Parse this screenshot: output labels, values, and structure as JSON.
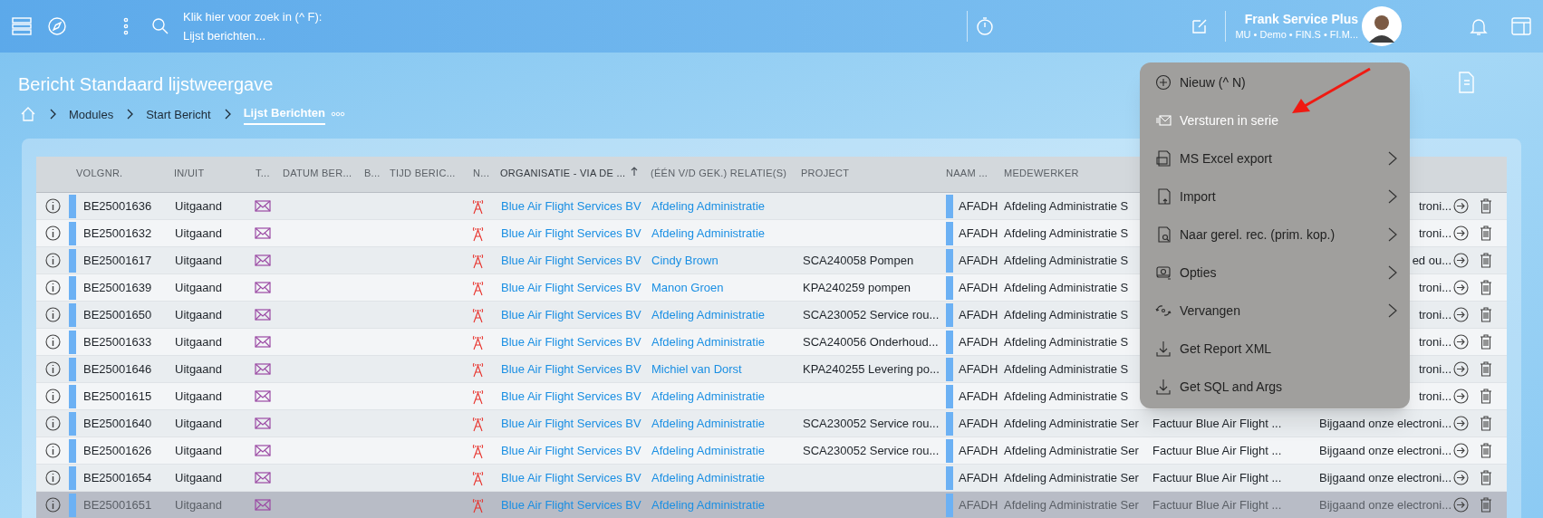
{
  "topbar": {
    "search": {
      "line_1": "Klik hier voor zoek in (^ F):",
      "line_2": "Lijst berichten..."
    },
    "user": {
      "name": "Frank Service Plus",
      "subtitle": "MU • Demo • FIN.S • FI.M..."
    }
  },
  "page_title": "Bericht Standaard lijstweergave",
  "breadcrumb": [
    {
      "label": "Modules",
      "selected": false
    },
    {
      "label": "Start Bericht",
      "selected": false
    },
    {
      "label": "Lijst Berichten",
      "selected": true
    }
  ],
  "table": {
    "columns": [
      {
        "label": "VOLGNR.",
        "sorted": false
      },
      {
        "label": "IN/UIT",
        "sorted": false
      },
      {
        "label": "T...",
        "sorted": false
      },
      {
        "label": "DATUM BER...",
        "sorted": false
      },
      {
        "label": "B...",
        "sorted": false
      },
      {
        "label": "TIJD BERIC...",
        "sorted": false
      },
      {
        "label": "N...",
        "sorted": false
      },
      {
        "label": "ORGANISATIE - VIA DE ...",
        "sorted": true
      },
      {
        "label": "(ÉÉN V/D GEK.) RELATIE(S)",
        "sorted": false
      },
      {
        "label": "PROJECT",
        "sorted": false
      },
      {
        "label": "NAAM ...",
        "sorted": false
      },
      {
        "label": "MEDEWERKER",
        "sorted": false
      }
    ],
    "rows": [
      {
        "selected": false,
        "number": "BE25001636",
        "direction": "Uitgaand",
        "organisation": "Blue Air Flight Services BV",
        "relation": "Afdeling Administratie",
        "name": "AFADH",
        "employee": "Afdeling Administratie S",
        "note": "troni..."
      },
      {
        "selected": false,
        "number": "BE25001632",
        "direction": "Uitgaand",
        "organisation": "Blue Air Flight Services BV",
        "relation": "Afdeling Administratie",
        "name": "AFADH",
        "employee": "Afdeling Administratie S",
        "note": "troni..."
      },
      {
        "selected": false,
        "number": "BE25001617",
        "direction": "Uitgaand",
        "organisation": "Blue Air Flight Services BV",
        "relation": "Cindy Brown",
        "project": "SCA240058 Pompen",
        "name": "AFADH",
        "employee": "Afdeling Administratie S",
        "note": "ed ou..."
      },
      {
        "selected": false,
        "number": "BE25001639",
        "direction": "Uitgaand",
        "organisation": "Blue Air Flight Services BV",
        "relation": "Manon Groen",
        "project": "KPA240259 pompen",
        "name": "AFADH",
        "employee": "Afdeling Administratie S",
        "note": "troni..."
      },
      {
        "selected": false,
        "number": "BE25001650",
        "direction": "Uitgaand",
        "organisation": "Blue Air Flight Services BV",
        "relation": "Afdeling Administratie",
        "project": "SCA230052 Service rou...",
        "name": "AFADH",
        "employee": "Afdeling Administratie S",
        "note": "troni..."
      },
      {
        "selected": false,
        "number": "BE25001633",
        "direction": "Uitgaand",
        "organisation": "Blue Air Flight Services BV",
        "relation": "Afdeling Administratie",
        "project": "SCA240056 Onderhoud...",
        "name": "AFADH",
        "employee": "Afdeling Administratie S",
        "note": "troni..."
      },
      {
        "selected": false,
        "number": "BE25001646",
        "direction": "Uitgaand",
        "organisation": "Blue Air Flight Services BV",
        "relation": "Michiel van Dorst",
        "project": "KPA240255 Levering po...",
        "name": "AFADH",
        "employee": "Afdeling Administratie S",
        "note": "troni..."
      },
      {
        "selected": false,
        "number": "BE25001615",
        "direction": "Uitgaand",
        "organisation": "Blue Air Flight Services BV",
        "relation": "Afdeling Administratie",
        "name": "AFADH",
        "employee": "Afdeling Administratie S",
        "note": "troni..."
      },
      {
        "selected": false,
        "number": "BE25001640",
        "direction": "Uitgaand",
        "organisation": "Blue Air Flight Services BV",
        "relation": "Afdeling Administratie",
        "project": "SCA230052 Service rou...",
        "name": "AFADH",
        "employee": "Afdeling Administratie Ser",
        "subject": "Factuur Blue Air Flight ...",
        "note": "Bijgaand onze electroni..."
      },
      {
        "selected": false,
        "number": "BE25001626",
        "direction": "Uitgaand",
        "organisation": "Blue Air Flight Services BV",
        "relation": "Afdeling Administratie",
        "project": "SCA230052 Service rou...",
        "name": "AFADH",
        "employee": "Afdeling Administratie Ser",
        "subject": "Factuur Blue Air Flight ...",
        "note": "Bijgaand onze electroni..."
      },
      {
        "selected": false,
        "number": "BE25001654",
        "direction": "Uitgaand",
        "organisation": "Blue Air Flight Services BV",
        "relation": "Afdeling Administratie",
        "name": "AFADH",
        "employee": "Afdeling Administratie Ser",
        "subject": "Factuur Blue Air Flight ...",
        "note": "Bijgaand onze electroni..."
      },
      {
        "selected": true,
        "number": "BE25001651",
        "direction": "Uitgaand",
        "organisation": "Blue Air Flight Services BV",
        "relation": "Afdeling Administratie",
        "name": "AFADH",
        "employee": "Afdeling Administratie Ser",
        "subject": "Factuur Blue Air Flight ...",
        "note": "Bijgaand onze electroni..."
      }
    ]
  },
  "menu": {
    "items": [
      {
        "kind": "plus",
        "label": "Nieuw (^ N)",
        "submenu": false,
        "highlighted": false
      },
      {
        "kind": "mail",
        "label": "Versturen in serie",
        "submenu": false,
        "highlighted": true
      },
      {
        "kind": "excel",
        "label": "MS Excel export",
        "submenu": true,
        "highlighted": false
      },
      {
        "kind": "import",
        "label": "Import",
        "submenu": true,
        "highlighted": false
      },
      {
        "kind": "find",
        "label": "Naar gerel. rec. (prim. kop.)",
        "submenu": true,
        "highlighted": false
      },
      {
        "kind": "options",
        "label": "Opties",
        "submenu": true,
        "highlighted": false
      },
      {
        "kind": "replace",
        "label": "Vervangen",
        "submenu": true,
        "highlighted": false
      },
      {
        "kind": "download",
        "label": "Get Report XML",
        "submenu": false,
        "highlighted": false
      },
      {
        "kind": "download",
        "label": "Get SQL and Args",
        "submenu": false,
        "highlighted": false
      }
    ]
  }
}
